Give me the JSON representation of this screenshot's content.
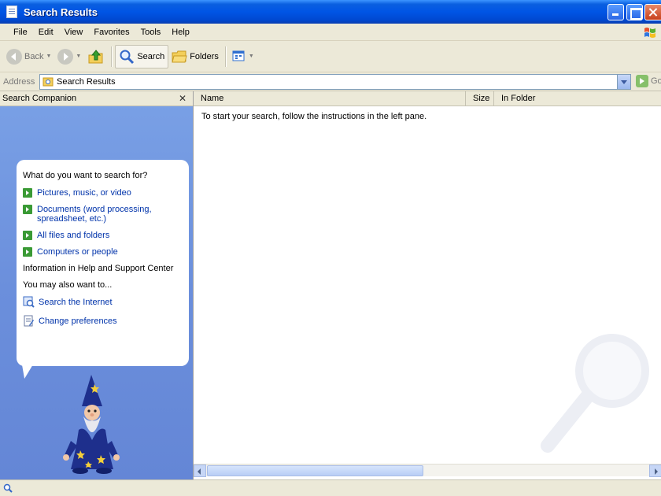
{
  "window": {
    "title": "Search Results",
    "title_icon": "search-results-icon"
  },
  "menu": {
    "items": [
      "File",
      "Edit",
      "View",
      "Favorites",
      "Tools",
      "Help"
    ],
    "logo_icon": "windows-flag-icon"
  },
  "toolbar": {
    "back_label": "Back",
    "search_label": "Search",
    "folders_label": "Folders",
    "icons": {
      "back": "back-arrow-icon",
      "forward": "forward-arrow-icon",
      "up": "up-folder-icon",
      "search": "search-icon",
      "folders": "folders-icon",
      "views": "views-icon"
    }
  },
  "address": {
    "label": "Address",
    "value": "Search Results",
    "go_label": "Go"
  },
  "search_companion": {
    "header": "Search Companion",
    "question": "What do you want to search for?",
    "options": [
      {
        "label": "Pictures, music, or video",
        "icon": "green-arrow-icon"
      },
      {
        "label": "Documents (word processing, spreadsheet, etc.)",
        "icon": "green-arrow-icon"
      },
      {
        "label": "All files and folders",
        "icon": "green-arrow-icon"
      },
      {
        "label": "Computers or people",
        "icon": "green-arrow-icon"
      }
    ],
    "help_text": "Information in Help and Support Center",
    "also_label": "You may also want to...",
    "alt_options": [
      {
        "label": "Search the Internet",
        "icon": "search-internet-icon"
      },
      {
        "label": "Change preferences",
        "icon": "preferences-icon"
      }
    ],
    "character_icon": "search-wizard-character"
  },
  "results": {
    "columns": [
      "Name",
      "Size",
      "In Folder"
    ],
    "empty_message": "To start your search, follow the instructions in the left pane.",
    "watermark_icon": "magnifier-watermark-icon"
  },
  "status": {
    "icon": "status-search-icon",
    "text": ""
  },
  "colors": {
    "titlebar": "#0055e5",
    "chrome": "#ece9d8",
    "companion_bg": "#6b8fdc",
    "link_blue": "#0033aa",
    "green_arrow": "#3a9a35"
  }
}
